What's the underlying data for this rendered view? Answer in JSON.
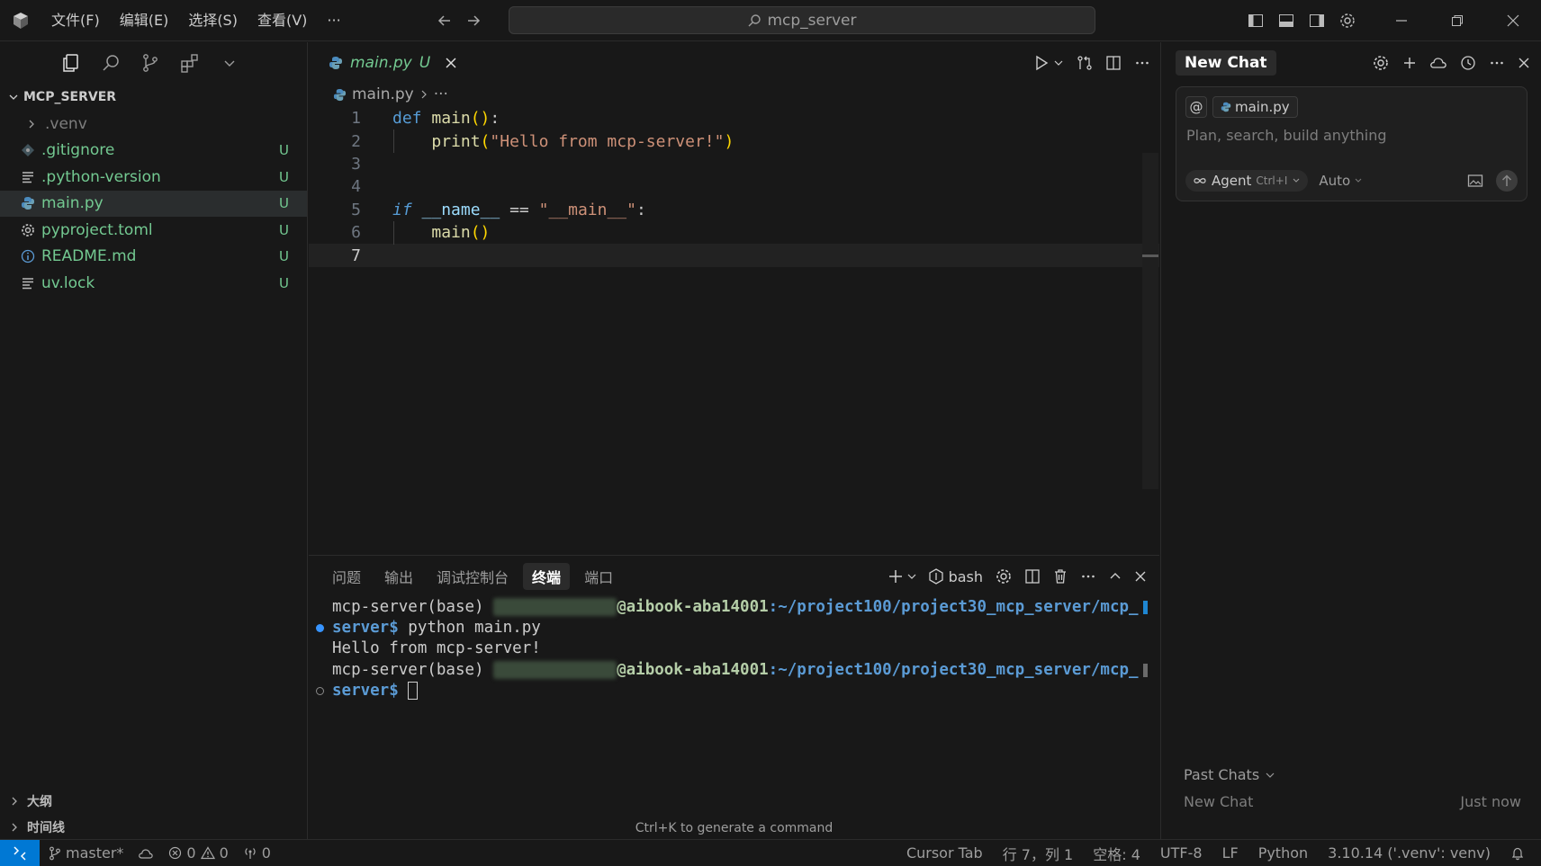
{
  "titlebar": {
    "menus": [
      "文件(F)",
      "编辑(E)",
      "选择(S)",
      "查看(V)",
      "···"
    ],
    "search_text": "mcp_server"
  },
  "sidebar": {
    "root_label": "MCP_SERVER",
    "files": [
      {
        "name": ".venv",
        "type": "folder",
        "badge": ""
      },
      {
        "name": ".gitignore",
        "type": "git",
        "badge": "U"
      },
      {
        "name": ".python-version",
        "type": "text",
        "badge": "U"
      },
      {
        "name": "main.py",
        "type": "python",
        "badge": "U"
      },
      {
        "name": "pyproject.toml",
        "type": "gear",
        "badge": "U"
      },
      {
        "name": "README.md",
        "type": "info",
        "badge": "U"
      },
      {
        "name": "uv.lock",
        "type": "text",
        "badge": "U"
      }
    ],
    "outline_label": "大纲",
    "timeline_label": "时间线"
  },
  "editor": {
    "tab_label": "main.py",
    "tab_badge": "U",
    "breadcrumb_file": "main.py",
    "breadcrumb_more": "···",
    "line_numbers": [
      "1",
      "2",
      "3",
      "4",
      "5",
      "6",
      "7"
    ]
  },
  "panel": {
    "tabs": [
      "问题",
      "输出",
      "调试控制台",
      "终端",
      "端口"
    ],
    "active_tab": "终端",
    "shell_label": "bash",
    "terminal": {
      "prompt_prefix": "mcp-server(base) ",
      "host": "@aibook-aba14001",
      "path": ":~/project100/project30_mcp_server/mcp_",
      "prompt_end": "server$ ",
      "command": "python main.py",
      "output": "Hello from mcp-server!"
    },
    "hint": "Ctrl+K to generate a command"
  },
  "chat": {
    "tab_label": "New Chat",
    "context_at": "@",
    "context_file": "main.py",
    "placeholder": "Plan, search, build anything",
    "agent_label": "Agent",
    "agent_shortcut": "Ctrl+I",
    "model_label": "Auto",
    "past_chats_label": "Past Chats",
    "past_chat_title": "New Chat",
    "past_chat_time": "Just now"
  },
  "statusbar": {
    "branch": "master*",
    "errors": "0",
    "warnings": "0",
    "ports": "0",
    "cursor_tab": "Cursor Tab",
    "position": "行 7，列 1",
    "spaces": "空格: 4",
    "encoding": "UTF-8",
    "eol": "LF",
    "language": "Python",
    "interpreter": "3.10.14 ('.venv': venv)"
  },
  "colors": {
    "accent": "#0078d4",
    "untracked": "#73c991",
    "background": "#181818"
  }
}
